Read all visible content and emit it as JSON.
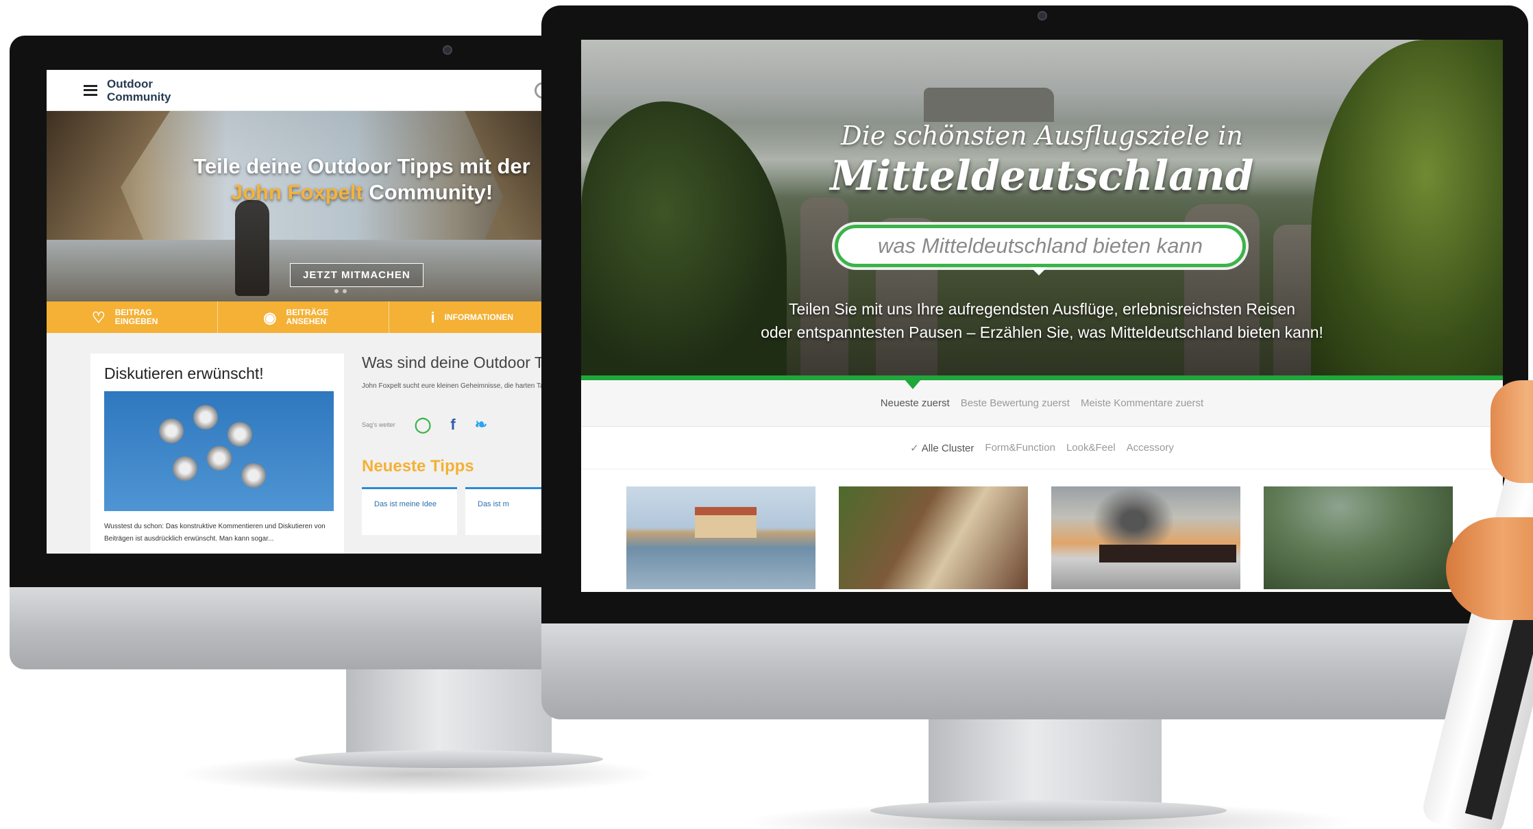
{
  "left_site": {
    "brand": "Outdoor Community",
    "hero": {
      "line1": "Teile deine Outdoor Tipps mit der",
      "highlight": "John Foxpelt",
      "line2_rest": " Community!",
      "cta": "JETZT MITMACHEN"
    },
    "actions": [
      {
        "icon": "lightbulb-icon",
        "glyph": "♡",
        "label": "BEITRAG EINGEBEN"
      },
      {
        "icon": "eye-icon",
        "glyph": "◉",
        "label": "BEITRÄGE ANSEHEN"
      },
      {
        "icon": "info-icon",
        "glyph": "i",
        "label": "INFORMATIONEN"
      }
    ],
    "card": {
      "title": "Diskutieren erwünscht!",
      "text": "Wusstest du schon: Das konstruktive Kommentieren und Diskutieren von Beiträgen ist ausdrücklich erwünscht. Man kann sogar..."
    },
    "column": {
      "title": "Was sind deine Outdoor T",
      "text": "John Foxpelt sucht eure kleinen Geheimnisse, die harten Tage in der Natur überstehen lassen!",
      "share_label": "Sag's weiter",
      "share_whatsapp": "◯",
      "share_facebook": "f",
      "share_twitter": "❧",
      "tips_title": "Neueste Tipps",
      "tips": [
        "Das ist meine Idee",
        "Das ist m"
      ]
    }
  },
  "right_site": {
    "hero": {
      "title_line1": "Die schönsten Ausflugsziele in",
      "title_line2": "Mitteldeutschland",
      "search_placeholder": "was Mitteldeutschland bieten kann",
      "subtitle_line1": "Teilen Sie mit uns Ihre aufregendsten Ausflüge, erlebnisreichsten Reisen",
      "subtitle_line2": "oder entspanntesten Pausen – Erzählen Sie, was Mitteldeutschland bieten kann!"
    },
    "sort_tabs": [
      {
        "label": "Neueste zuerst",
        "active": true
      },
      {
        "label": "Beste Bewertung zuerst",
        "active": false
      },
      {
        "label": "Meiste Kommentare zuerst",
        "active": false
      }
    ],
    "filter_check": "✓",
    "filters": [
      {
        "label": "Alle Cluster",
        "active": true
      },
      {
        "label": "Form&Function",
        "active": false
      },
      {
        "label": "Look&Feel",
        "active": false
      },
      {
        "label": "Accessory",
        "active": false
      }
    ]
  },
  "colors": {
    "accent_orange": "#f4b135",
    "accent_green": "#1fa73b",
    "search_border": "#3bb34a",
    "link_blue": "#2a8bd6"
  }
}
